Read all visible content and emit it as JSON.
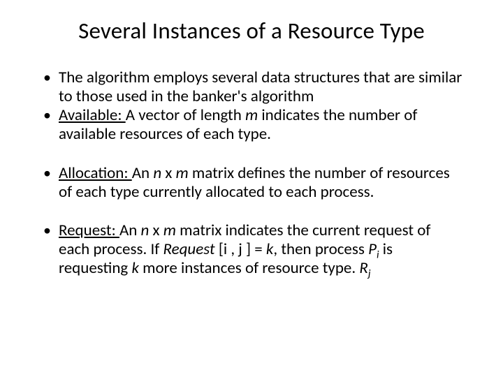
{
  "title": "Several Instances of a Resource Type",
  "b1": "The algorithm employs several data structures that are similar to those used in the banker's algorithm",
  "b2_label": "Available:  ",
  "b2_p1": "A vector of length ",
  "b2_m": "m",
  "b2_p2": " indicates the number of available resources of each type.",
  "b3_label": "Allocation:  ",
  "b3_p1": "An ",
  "b3_n": "n",
  "b3_x": " x ",
  "b3_m": "m",
  "b3_p2": " matrix defines the number of resources of each type currently allocated to each process.",
  "b4_label": "Request:  ",
  "b4_p1": "An ",
  "b4_n": "n",
  "b4_x": " x ",
  "b4_m": "m",
  "b4_p2": " matrix indicates the current request of each process.  If ",
  "b4_req": "Request ",
  "b4_idx": "[i , j ] = ",
  "b4_k": "k",
  "b4_p3": ", then process ",
  "b4_P": "P",
  "b4_i": "i",
  "b4_p4": " is requesting ",
  "b4_k2": "k",
  "b4_p5": " more instances of resource type. ",
  "b4_R": "R",
  "b4_j": "j"
}
